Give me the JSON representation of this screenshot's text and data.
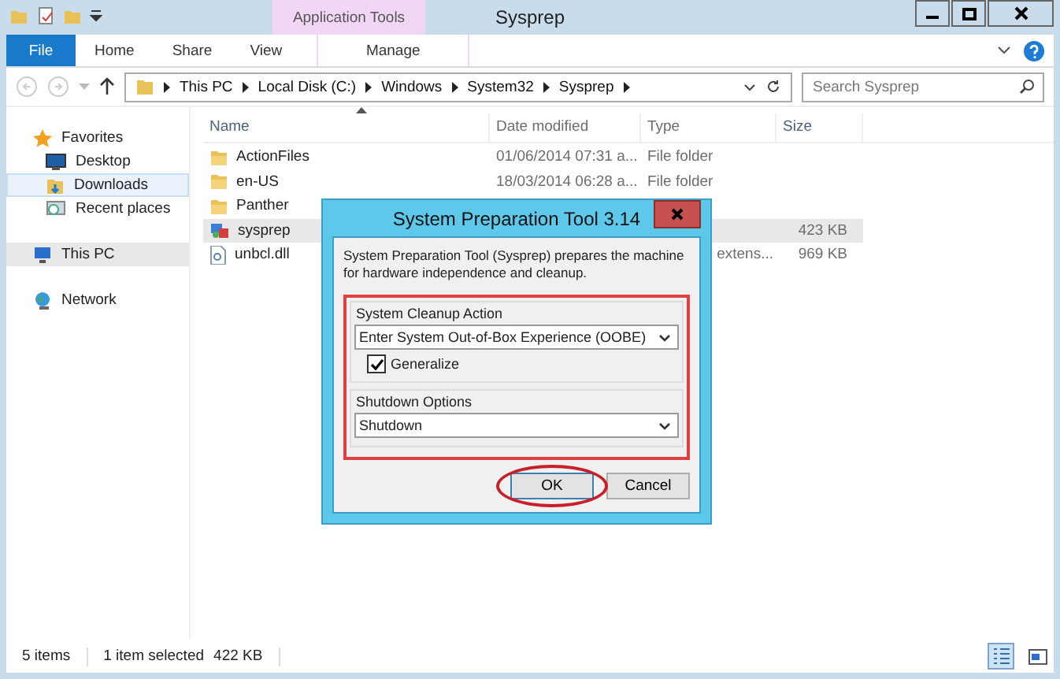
{
  "window": {
    "title": "Sysprep"
  },
  "contextual": {
    "group": "Application Tools",
    "tab": "Manage"
  },
  "file_tab": "File",
  "tabs": [
    "Home",
    "Share",
    "View"
  ],
  "address": {
    "crumbs": [
      "This PC",
      "Local Disk (C:)",
      "Windows",
      "System32",
      "Sysprep"
    ]
  },
  "search": {
    "placeholder": "Search Sysprep"
  },
  "sidebar": [
    {
      "label": "Favorites",
      "kind": "star",
      "selected": false,
      "hover": false,
      "children": [
        {
          "label": "Desktop",
          "kind": "desktop",
          "selected": false,
          "hover": false
        },
        {
          "label": "Downloads",
          "kind": "downloads",
          "selected": true,
          "hover": false
        },
        {
          "label": "Recent places",
          "kind": "recent",
          "selected": false,
          "hover": false
        }
      ]
    },
    {
      "label": "This PC",
      "kind": "pc",
      "selected": false,
      "hover": true
    },
    {
      "label": "Network",
      "kind": "network",
      "selected": false,
      "hover": false
    }
  ],
  "columns": [
    "Name",
    "Date modified",
    "Type",
    "Size"
  ],
  "rows": [
    {
      "name": "ActionFiles",
      "kind": "folder",
      "date": "01/06/2014 07:31 a...",
      "type": "File folder",
      "size": "",
      "selected": false
    },
    {
      "name": "en-US",
      "kind": "folder",
      "date": "18/03/2014 06:28 a...",
      "type": "File folder",
      "size": "",
      "selected": false
    },
    {
      "name": "Panther",
      "kind": "folder",
      "date": "",
      "type": "",
      "size": "",
      "selected": false
    },
    {
      "name": "sysprep",
      "kind": "app",
      "date": "",
      "type": "",
      "size": "423 KB",
      "selected": true
    },
    {
      "name": "unbcl.dll",
      "kind": "dll",
      "date": "",
      "type": "extens...",
      "size": "969 KB",
      "selected": false
    }
  ],
  "status": {
    "count": "5 items",
    "selection": "1 item selected",
    "size": "422 KB"
  },
  "views": [
    {
      "kind": "details",
      "selected": true
    },
    {
      "kind": "tiles",
      "selected": false
    }
  ],
  "dialog": {
    "title": "System Preparation Tool 3.14",
    "description": "System Preparation Tool (Sysprep) prepares the machine for hardware independence and cleanup.",
    "cleanup": {
      "label": "System Cleanup Action",
      "value": "Enter System Out-of-Box Experience (OOBE)"
    },
    "generalize": {
      "label": "Generalize",
      "checked": true
    },
    "shutdown": {
      "label": "Shutdown Options",
      "value": "Shutdown"
    },
    "buttons": [
      "OK",
      "Cancel"
    ]
  }
}
